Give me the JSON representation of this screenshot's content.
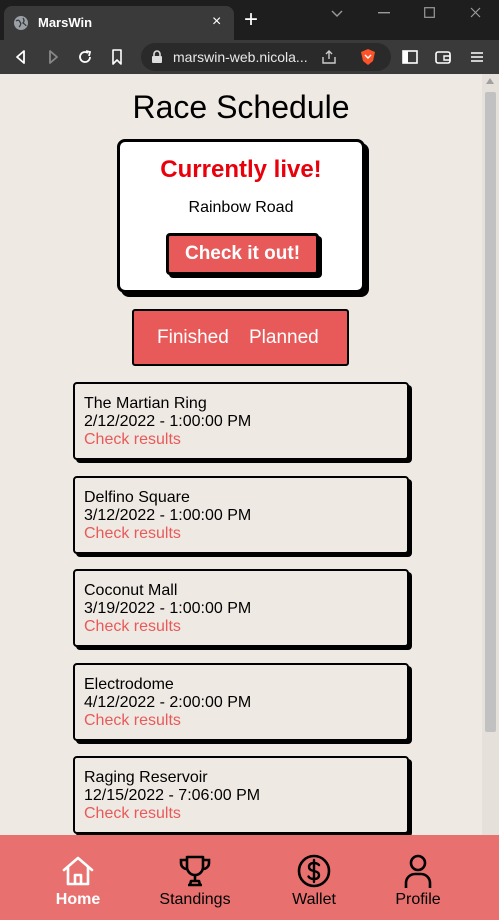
{
  "browser": {
    "tab_title": "MarsWin",
    "tab_close": "×",
    "new_tab": "+",
    "url": "marswin-web.nicola..."
  },
  "page": {
    "title": "Race Schedule",
    "live": {
      "heading": "Currently live!",
      "track": "Rainbow Road",
      "button": "Check it out!"
    },
    "filter": {
      "finished": "Finished",
      "planned": "Planned"
    },
    "races": [
      {
        "name": "The Martian Ring",
        "date": "2/12/2022 - 1:00:00 PM",
        "link": "Check results"
      },
      {
        "name": "Delfino Square",
        "date": "3/12/2022 - 1:00:00 PM",
        "link": "Check results"
      },
      {
        "name": "Coconut Mall",
        "date": "3/19/2022 - 1:00:00 PM",
        "link": "Check results"
      },
      {
        "name": "Electrodome",
        "date": "4/12/2022 - 2:00:00 PM",
        "link": "Check results"
      },
      {
        "name": "Raging Reservoir",
        "date": "12/15/2022 - 7:06:00 PM",
        "link": "Check results"
      }
    ]
  },
  "bottom_nav": {
    "items": [
      {
        "label": "Home",
        "icon": "home-icon",
        "active": true
      },
      {
        "label": "Standings",
        "icon": "trophy-icon",
        "active": false
      },
      {
        "label": "Wallet",
        "icon": "dollar-coin-icon",
        "active": false
      },
      {
        "label": "Profile",
        "icon": "person-icon",
        "active": false
      }
    ]
  },
  "colors": {
    "accent": "#e85a5a",
    "live_red": "#e8000b",
    "nav_bg": "#e8716f",
    "page_bg": "#efe9e3"
  }
}
